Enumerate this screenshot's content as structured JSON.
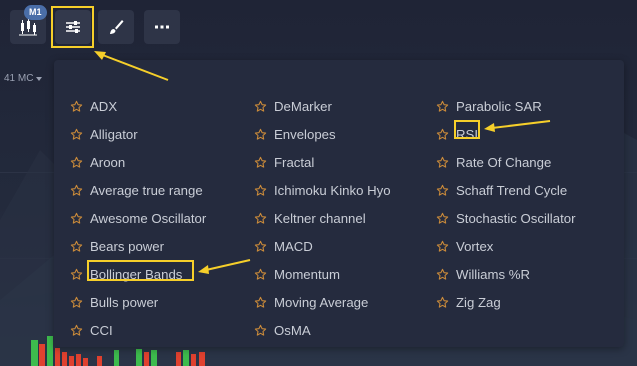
{
  "toolbar": {
    "badge": "M1",
    "buttons": [
      {
        "name": "chart-type-button",
        "icon": "candlestick-icon"
      },
      {
        "name": "indicators-button",
        "icon": "sliders-icon",
        "active": true
      },
      {
        "name": "drawing-tools-button",
        "icon": "brush-icon"
      },
      {
        "name": "more-button",
        "icon": "more-icon"
      }
    ]
  },
  "timeframe": {
    "label": "41 МС"
  },
  "indicators": {
    "columns": [
      [
        "ADX",
        "Alligator",
        "Aroon",
        "Average true range",
        "Awesome Oscillator",
        "Bears power",
        "Bollinger Bands",
        "Bulls power",
        "CCI"
      ],
      [
        "DeMarker",
        "Envelopes",
        "Fractal",
        "Ichimoku Kinko Hyo",
        "Keltner channel",
        "MACD",
        "Momentum",
        "Moving Average",
        "OsMA"
      ],
      [
        "Parabolic SAR",
        "RSI",
        "Rate Of Change",
        "Schaff Trend Cycle",
        "Stochastic Oscillator",
        "Vortex",
        "Williams %R",
        "Zig Zag"
      ]
    ],
    "highlighted": [
      "Bollinger Bands",
      "RSI"
    ]
  },
  "colors": {
    "highlight": "#f6cf2a",
    "star": "#c98a3a",
    "panel": "#252b3e",
    "text": "#c9cdd6",
    "candle_up": "#3dbb4d",
    "candle_down": "#e0412f"
  }
}
